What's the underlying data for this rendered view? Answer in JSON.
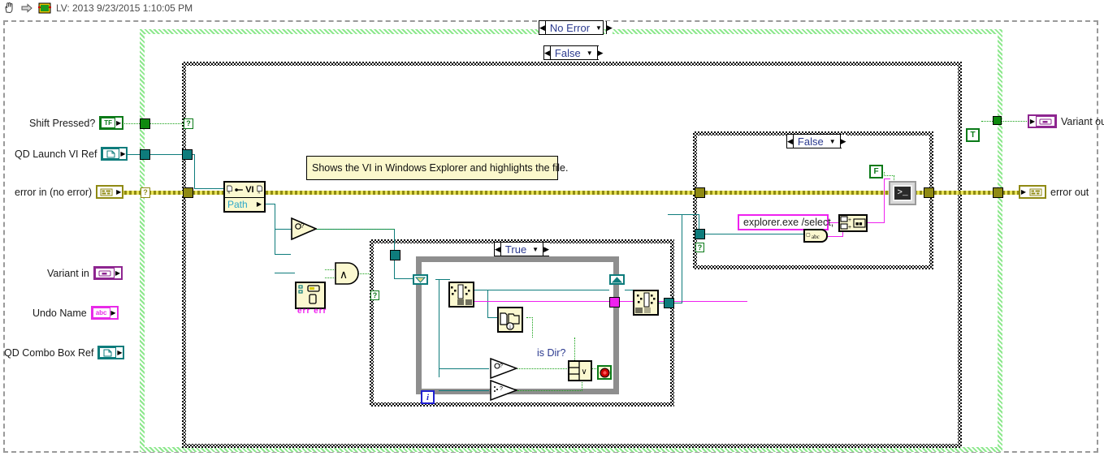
{
  "window": {
    "title": "LV: 2013 9/23/2015 1:10:05 PM",
    "icons": [
      "hand-cursor-icon",
      "arrow-right-icon",
      "labview-vi-icon"
    ]
  },
  "structures": {
    "outer_case_label": "No Error",
    "middle_case_label": "False",
    "right_case_label": "False",
    "inner_case_label": "True",
    "nav_left": "◀",
    "nav_right": "▶",
    "chevron": "▼"
  },
  "inputs": [
    {
      "label": "Shift Pressed?",
      "glyph": "TF",
      "type": "boolean"
    },
    {
      "label": "QD Launch VI Ref",
      "glyph": "❐",
      "type": "refnum"
    },
    {
      "label": "error in (no error)",
      "glyph": "⌗",
      "type": "error-cluster"
    },
    {
      "label": "Variant in",
      "glyph": "▭",
      "type": "variant"
    },
    {
      "label": "Undo Name",
      "glyph": "abc",
      "type": "string"
    },
    {
      "label": "QD Combo Box Ref",
      "glyph": "❐",
      "type": "refnum"
    }
  ],
  "outputs": [
    {
      "label": "Variant out",
      "glyph": "▭",
      "type": "variant"
    },
    {
      "label": "error out",
      "glyph": "⌗",
      "type": "error-cluster"
    }
  ],
  "comment": {
    "text": "Shows the VI in Windows Explorer and highlights the file."
  },
  "property_node": {
    "class": "VI",
    "property": "Path"
  },
  "constants": {
    "explorer_command": "explorer.exe /select,",
    "boolean_true": "T",
    "boolean_false": "F"
  },
  "labels": {
    "is_dir": "is Dir?",
    "err_err": "err err",
    "iteration": "i"
  },
  "nodes": {
    "system_exec": "system-exec-icon",
    "concatenate_strings": "concatenate-strings-icon",
    "path_to_string": "path-to-string-icon",
    "build_path_array": "strip-path-icon",
    "file_dir_info": "file-directory-info-icon",
    "variant_to_data": "variant-to-data-icon",
    "not_a_refnum": "not-a-number-path-refnum-icon",
    "error_cluster_unbundle": "unbundle-error-icon",
    "and_gate": "and-gate-icon",
    "or_gate": "or-gate-icon",
    "empty_path": "empty-path-icon",
    "stop_terminal": "loop-stop-icon"
  },
  "colors": {
    "boolean_green": "#0a7a18",
    "refnum_teal": "#0e7c7c",
    "error_olive": "#8f8a13",
    "variant_purple": "#8e2590",
    "string_magenta": "#ef21ef",
    "structure_green": "#8de88d",
    "loop_gray": "#8e8e8e",
    "comment_yellow": "#fbf8cc",
    "node_yellow": "#fbf8d0"
  }
}
